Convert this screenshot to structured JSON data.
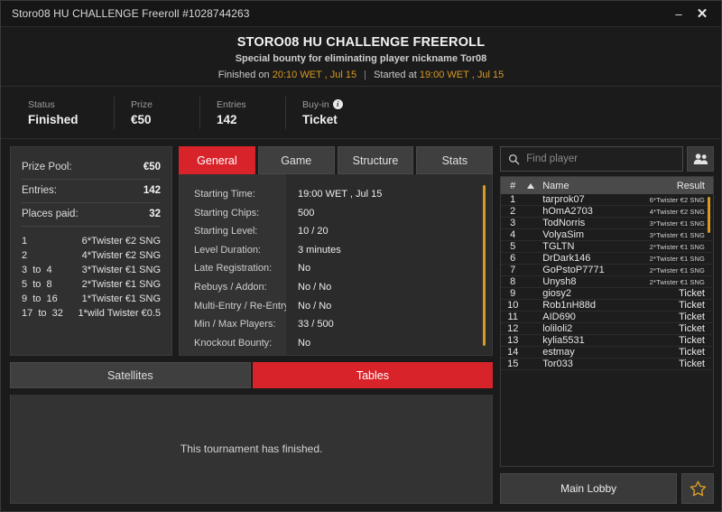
{
  "window": {
    "title": "Storo08 HU CHALLENGE Freeroll #1028744263",
    "minimize_label": "–",
    "close_label": "✕"
  },
  "header": {
    "title": "STORO08 HU CHALLENGE FREEROLL",
    "subtitle": "Special bounty for eliminating player nickname Tor08",
    "finished_prefix": "Finished on",
    "finished_time": "20:10 WET , Jul 15",
    "separator": "|",
    "started_prefix": "Started at",
    "started_time": "19:00 WET , Jul 15"
  },
  "stats": [
    {
      "label": "Status",
      "value": "Finished",
      "info": false
    },
    {
      "label": "Prize",
      "value": "€50",
      "info": false
    },
    {
      "label": "Entries",
      "value": "142",
      "info": false
    },
    {
      "label": "Buy-in",
      "value": "Ticket",
      "info": true,
      "info_glyph": "i"
    }
  ],
  "prize_panel": {
    "rows": [
      {
        "label": "Prize Pool:",
        "value": "€50"
      },
      {
        "label": "Entries:",
        "value": "142"
      },
      {
        "label": "Places paid:",
        "value": "32"
      }
    ],
    "payouts": [
      {
        "position": "1",
        "prize": "6*Twister €2 SNG"
      },
      {
        "position": "2",
        "prize": "4*Twister €2 SNG"
      },
      {
        "position": "3  to  4",
        "prize": "3*Twister €1 SNG"
      },
      {
        "position": "5  to  8",
        "prize": "2*Twister €1 SNG"
      },
      {
        "position": "9  to  16",
        "prize": "1*Twister €1 SNG"
      },
      {
        "position": "17  to  32",
        "prize": "1*wild Twister €0.5"
      }
    ]
  },
  "tabs": [
    {
      "label": "General",
      "active": true
    },
    {
      "label": "Game",
      "active": false
    },
    {
      "label": "Structure",
      "active": false
    },
    {
      "label": "Stats",
      "active": false
    }
  ],
  "general_info": [
    {
      "label": "Starting Time:",
      "value": "19:00 WET , Jul 15"
    },
    {
      "label": "Starting Chips:",
      "value": "500"
    },
    {
      "label": "Starting Level:",
      "value": "10 / 20"
    },
    {
      "label": "Level Duration:",
      "value": "3 minutes"
    },
    {
      "label": "Late Registration:",
      "value": "No"
    },
    {
      "label": "Rebuys / Addon:",
      "value": "No / No"
    },
    {
      "label": "Multi-Entry / Re-Entry:",
      "value": "No / No"
    },
    {
      "label": "Min / Max Players:",
      "value": "33 / 500"
    },
    {
      "label": "Knockout Bounty:",
      "value": "No"
    }
  ],
  "sub_tabs": [
    {
      "label": "Satellites",
      "active": false
    },
    {
      "label": "Tables",
      "active": true
    }
  ],
  "tables_panel": {
    "message": "This tournament has finished."
  },
  "search": {
    "placeholder": "Find player",
    "value": "",
    "icon": "search-icon",
    "people_icon": "people-icon"
  },
  "player_table": {
    "columns": {
      "num": "#",
      "sort": "▲",
      "name": "Name",
      "result": "Result"
    },
    "rows": [
      {
        "num": "1",
        "name": "tarprok07",
        "result": "6*Twister €2 SNG",
        "small": true
      },
      {
        "num": "2",
        "name": "hOmA2703",
        "result": "4*Twister €2 SNG",
        "small": true
      },
      {
        "num": "3",
        "name": "TodNorris",
        "result": "3*Twister €1 SNG",
        "small": true
      },
      {
        "num": "4",
        "name": "VolyaSim",
        "result": "3*Twister €1 SNG",
        "small": true
      },
      {
        "num": "5",
        "name": "TGLTN",
        "result": "2*Twister €1 SNG",
        "small": true
      },
      {
        "num": "6",
        "name": "DrDark146",
        "result": "2*Twister €1 SNG",
        "small": true
      },
      {
        "num": "7",
        "name": "GoPstoP7771",
        "result": "2*Twister €1 SNG",
        "small": true
      },
      {
        "num": "8",
        "name": "Unysh8",
        "result": "2*Twister €1 SNG",
        "small": true
      },
      {
        "num": "9",
        "name": "giosy2",
        "result": "Ticket",
        "small": false
      },
      {
        "num": "10",
        "name": "Rob1nH88d",
        "result": "Ticket",
        "small": false
      },
      {
        "num": "11",
        "name": "AID690",
        "result": "Ticket",
        "small": false
      },
      {
        "num": "12",
        "name": "loliloli2",
        "result": "Ticket",
        "small": false
      },
      {
        "num": "13",
        "name": "kylia5531",
        "result": "Ticket",
        "small": false
      },
      {
        "num": "14",
        "name": "estmay",
        "result": "Ticket",
        "small": false
      },
      {
        "num": "15",
        "name": "Tor033",
        "result": "Ticket",
        "small": false
      }
    ]
  },
  "footer": {
    "main_lobby_label": "Main Lobby",
    "favourite_icon": "star-icon"
  },
  "colors": {
    "accent_red": "#d8232a",
    "accent_gold": "#d79a23",
    "window_bg": "#1b1b1b",
    "panel_bg": "#303030"
  }
}
